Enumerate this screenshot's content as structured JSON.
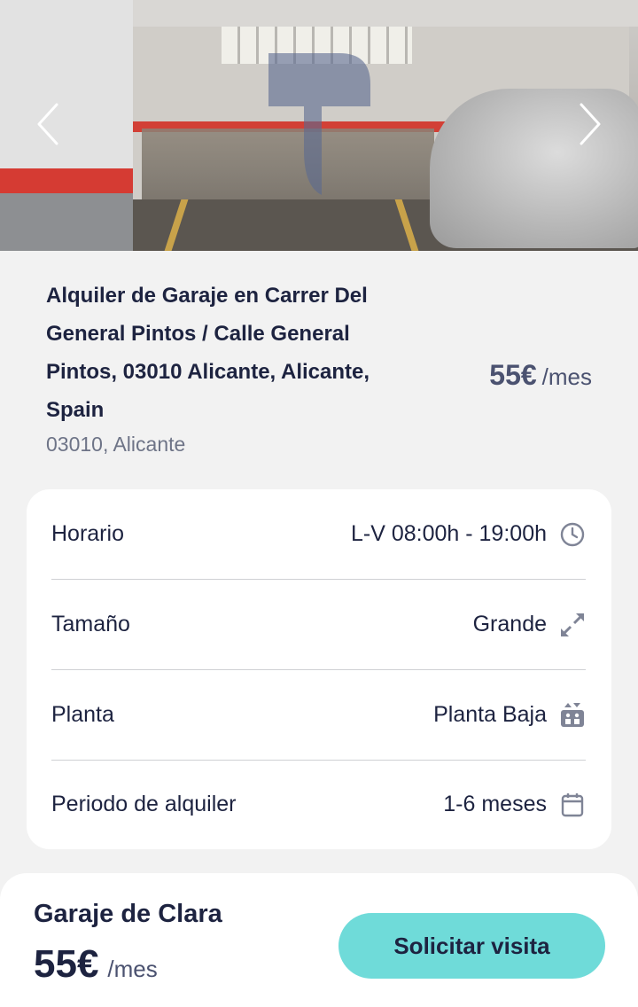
{
  "listing": {
    "title": "Alquiler de Garaje en Carrer Del General Pintos / Calle General Pintos, 03010 Alicante, Alicante, Spain",
    "location": "03010, Alicante",
    "price": {
      "amount": "55€",
      "unit": "/mes"
    }
  },
  "gallery": {
    "prev_icon": "chevron-left-icon",
    "next_icon": "chevron-right-icon"
  },
  "details": [
    {
      "label": "Horario",
      "value": "L-V 08:00h - 19:00h",
      "icon": "clock-icon"
    },
    {
      "label": "Tamaño",
      "value": "Grande",
      "icon": "expand-icon"
    },
    {
      "label": "Planta",
      "value": "Planta Baja",
      "icon": "elevator-icon"
    },
    {
      "label": "Periodo de alquiler",
      "value": "1-6 meses",
      "icon": "calendar-icon"
    }
  ],
  "footer": {
    "name": "Garaje de Clara",
    "price": {
      "amount": "55€",
      "unit": "/mes"
    },
    "cta_label": "Solicitar visita",
    "cta_color": "#6fdbd9"
  }
}
